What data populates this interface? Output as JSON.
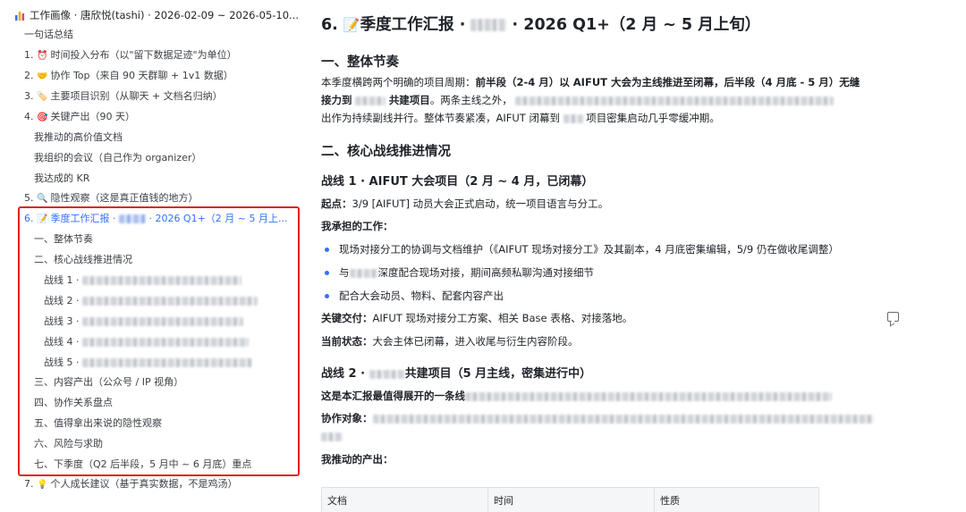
{
  "sidebar": {
    "doc_title": "工作画像 · 唐欣悦(tashi) · 2026-02-09 ~ 2026-05-10...",
    "items": [
      {
        "emoji": "",
        "label": "一句话总结"
      },
      {
        "emoji": "⏰",
        "label": "1. ",
        "text": "时间投入分布（以\"留下数据足迹\"为单位）"
      },
      {
        "emoji": "🤝",
        "label": "2. ",
        "text": "协作 Top（来自 90 天群聊 + 1v1 数据）"
      },
      {
        "emoji": "🏷️",
        "label": "3. ",
        "text": "主要项目识别（从聊天 + 文档名归纳）"
      },
      {
        "emoji": "🎯",
        "label": "4. ",
        "text": "关键产出（90 天）"
      },
      {
        "emoji": "",
        "label": "我推动的高价值文档"
      },
      {
        "emoji": "",
        "label": "我组织的会议（自己作为 organizer）"
      },
      {
        "emoji": "",
        "label": "我达成的 KR"
      },
      {
        "emoji": "🔍",
        "label": "5. ",
        "text": "隐性观察（这是真正值钱的地方）"
      },
      {
        "emoji": "📝",
        "label": "6. ",
        "text": "季度工作汇报 ·",
        "text2": "· 2026 Q1+（2 月 ~ 5 月上..."
      },
      {
        "emoji": "",
        "label": "一、整体节奏"
      },
      {
        "emoji": "",
        "label": "二、核心战线推进情况"
      },
      {
        "emoji": "",
        "label": "战线 1 ·"
      },
      {
        "emoji": "",
        "label": "战线 2 ·"
      },
      {
        "emoji": "",
        "label": "战线 3 ·"
      },
      {
        "emoji": "",
        "label": "战线 4 ·"
      },
      {
        "emoji": "",
        "label": "战线 5 ·"
      },
      {
        "emoji": "",
        "label": "三、内容产出（公众号 / IP 视角）"
      },
      {
        "emoji": "",
        "label": "四、协作关系盘点"
      },
      {
        "emoji": "",
        "label": "五、值得拿出来说的隐性观察"
      },
      {
        "emoji": "",
        "label": "六、风险与求助"
      },
      {
        "emoji": "",
        "label": "七、下季度（Q2 后半段，5 月中 ~ 6 月底）重点"
      },
      {
        "emoji": "💡",
        "label": "7. ",
        "text": "个人成长建议（基于真实数据，不是鸡汤）"
      }
    ]
  },
  "main": {
    "title_prefix": "6. ",
    "title_emoji": "📝",
    "title_a": "季度工作汇报 ·",
    "title_b": "· 2026 Q1+（2 月 ~ 5 月上旬）",
    "s1_heading": "一、整体节奏",
    "s1_p1_a": "本季度横跨两个明确的项目周期：",
    "s1_p1_b": "前半段（2-4 月）以 AIFUT 大会为主线推进至闭幕，后半段（4 月底 - 5 月）无缝",
    "s1_p2_a": "接力到",
    "s1_p2_b": "共建项目",
    "s1_p2_c": "。两条主线之外，",
    "s1_p3_a": "出作为持续副线并行。整体节奏紧凑，AIFUT 闭幕到",
    "s1_p3_b": "项目密集启动几乎零缓冲期。",
    "s2_heading": "二、核心战线推进情况",
    "line1_heading": "战线 1 · AIFUT 大会项目（2 月 ~ 4 月，已闭幕）",
    "line1_start_label": "起点：",
    "line1_start": "3/9 [AIFUT] 动员大会正式启动，统一项目语言与分工。",
    "line1_work_label": "我承担的工作：",
    "line1_bullets": [
      "现场对接分工的协调与文档维护（《AIFUT 现场对接分工》及其副本，4 月底密集编辑，5/9 仍在做收尾调整）",
      "深度配合现场对接，期间高频私聊沟通对接细节",
      "配合大会动员、物料、配套内容产出"
    ],
    "line1_bullet2_prefix": "与",
    "line1_deliver_label": "关键交付：",
    "line1_deliver": "AIFUT 现场对接分工方案、相关 Base 表格、对接落地。",
    "line1_status_label": "当前状态：",
    "line1_status": "大会主体已闭幕，进入收尾与衍生内容阶段。",
    "line2_heading_a": "战线 2 ·",
    "line2_heading_b": "共建项目（5 月主线，密集进行中）",
    "line2_p1": "这是本汇报最值得展开的一条线",
    "line2_p2_label": "协作对象：",
    "line2_output_label": "我推动的产出：",
    "table_headers": [
      "文档",
      "时间",
      "性质"
    ]
  },
  "colors": {
    "accent": "#3370ff",
    "highlight_box": "#e02020",
    "text": "#1f2329"
  },
  "icons": [
    "bar-chart-icon",
    "comment-icon"
  ]
}
